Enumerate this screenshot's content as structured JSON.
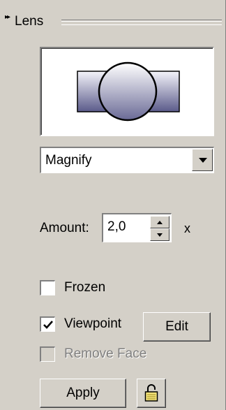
{
  "panel": {
    "title": "Lens",
    "collapse_icon": "double-arrow-right-icon"
  },
  "preview": {
    "icon": "lens-magnify-preview"
  },
  "mode_select": {
    "value": "Magnify"
  },
  "amount": {
    "label": "Amount:",
    "value": "2,0",
    "unit": "x"
  },
  "options": {
    "frozen": {
      "label": "Frozen",
      "checked": false,
      "enabled": true
    },
    "viewpoint": {
      "label": "Viewpoint",
      "checked": true,
      "enabled": true
    },
    "remove_face": {
      "label": "Remove Face",
      "checked": false,
      "enabled": false
    }
  },
  "buttons": {
    "edit": "Edit",
    "apply": "Apply",
    "lock_icon": "unlocked-padlock-icon"
  }
}
